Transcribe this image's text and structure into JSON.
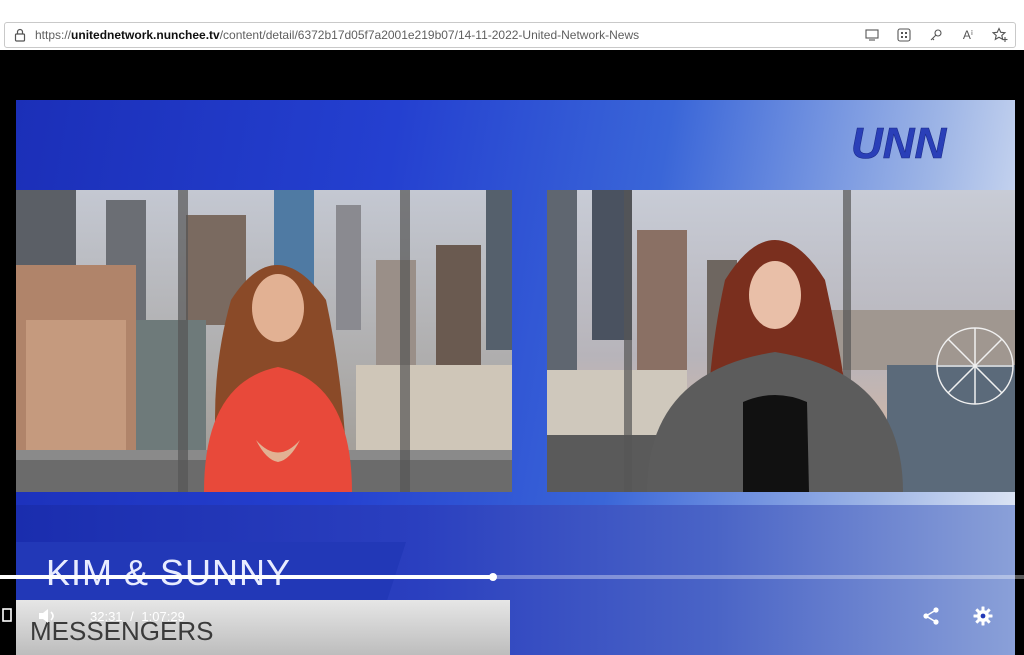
{
  "browser": {
    "url_scheme": "https://",
    "url_host": "unitednetwork.nunchee.tv",
    "url_path": "/content/detail/6372b17d05f7a2001e219b07/14-11-2022-United-Network-News",
    "icons": [
      "lock-icon",
      "read-mode-icon",
      "apps-icon",
      "key-icon",
      "read-aloud-icon",
      "favorites-icon"
    ],
    "read_aloud_label": "Aⁱ"
  },
  "video": {
    "logo_text": "UNN",
    "lower_third_name": "KIM & SUNNY",
    "lower_third_sub": "MESSENGERS",
    "colors": {
      "brand_blue": "#2238b7",
      "logo_blue": "#2a3fb8"
    }
  },
  "player": {
    "current_time": "32:31",
    "separator": "/",
    "duration": "1:07:29",
    "progress": 0.4818,
    "buttons": {
      "fullscreen": "fullscreen-icon",
      "volume": "volume-icon",
      "share": "share-icon",
      "settings": "gear-icon"
    }
  }
}
